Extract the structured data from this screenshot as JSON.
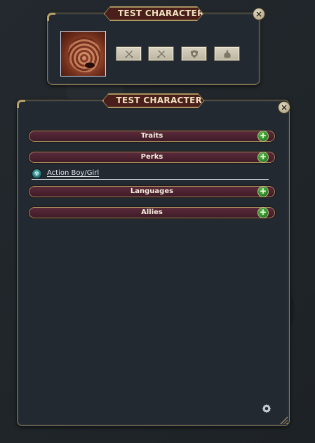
{
  "character_window": {
    "title": "TEST CHARACTER",
    "close_symbol": "×",
    "portrait_icon": "creature-portrait",
    "equipment_slots": [
      {
        "icon": "crossed-swords-icon"
      },
      {
        "icon": "crossed-tools-icon"
      },
      {
        "icon": "shield-icon"
      },
      {
        "icon": "pouch-icon"
      }
    ]
  },
  "sheet_window": {
    "title": "TEST CHARACTER",
    "close_symbol": "×",
    "sections": [
      {
        "label": "Traits",
        "add_symbol": "+"
      },
      {
        "label": "Perks",
        "add_symbol": "+"
      },
      {
        "label": "Languages",
        "add_symbol": "+"
      },
      {
        "label": "Allies",
        "add_symbol": "+"
      }
    ],
    "perks": [
      {
        "label": "Action Boy/Girl",
        "icon": "perk-badge-icon"
      }
    ]
  },
  "colors": {
    "background": "#20252a",
    "window": "#232930",
    "frame_gold": "#8c7c55",
    "title_tab": "#4a1e1a",
    "section_bar": "#4d2232",
    "add_button": "#2f8a2a"
  }
}
